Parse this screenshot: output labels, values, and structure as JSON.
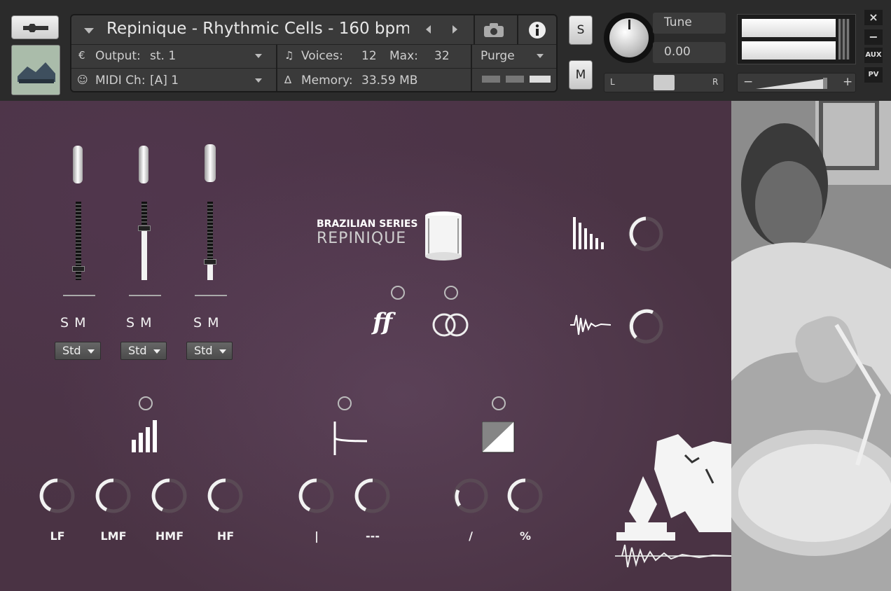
{
  "header": {
    "instrument_title": "Repinique - Rhythmic Cells - 160 bpm",
    "output_label": "Output:",
    "output_value": "st. 1",
    "voices_label": "Voices:",
    "voices_value": "12",
    "max_label": "Max:",
    "max_value": "32",
    "purge_label": "Purge",
    "midi_label": "MIDI Ch:",
    "midi_value": "[A]  1",
    "memory_label": "Memory:",
    "memory_value": "33.59 MB",
    "solo_label": "S",
    "mute_label": "M",
    "tune_label": "Tune",
    "tune_value": "0.00",
    "pan_left": "L",
    "pan_right": "R",
    "vol_minus": "−",
    "vol_plus": "+",
    "close_label": "×",
    "minimize_label": "−",
    "aux_label": "AUX",
    "pv_label": "PV"
  },
  "mixer": {
    "channels": [
      {
        "solo": "S",
        "mute": "M",
        "mode": "Std"
      },
      {
        "solo": "S",
        "mute": "M",
        "mode": "Std"
      },
      {
        "solo": "S",
        "mute": "M",
        "mode": "Std"
      }
    ]
  },
  "logo": {
    "series": "BRAZILIAN SERIES",
    "name": "REPINIQUE"
  },
  "eq": {
    "knobs": [
      "LF",
      "LMF",
      "HMF",
      "HF"
    ]
  },
  "mid_knobs": [
    "|",
    "---"
  ],
  "right_knobs": [
    "∕",
    "%"
  ],
  "colors": {
    "panel_bg": "#4a3344",
    "header_bg": "#2b2b2b",
    "text_light": "#f2f2f2"
  }
}
